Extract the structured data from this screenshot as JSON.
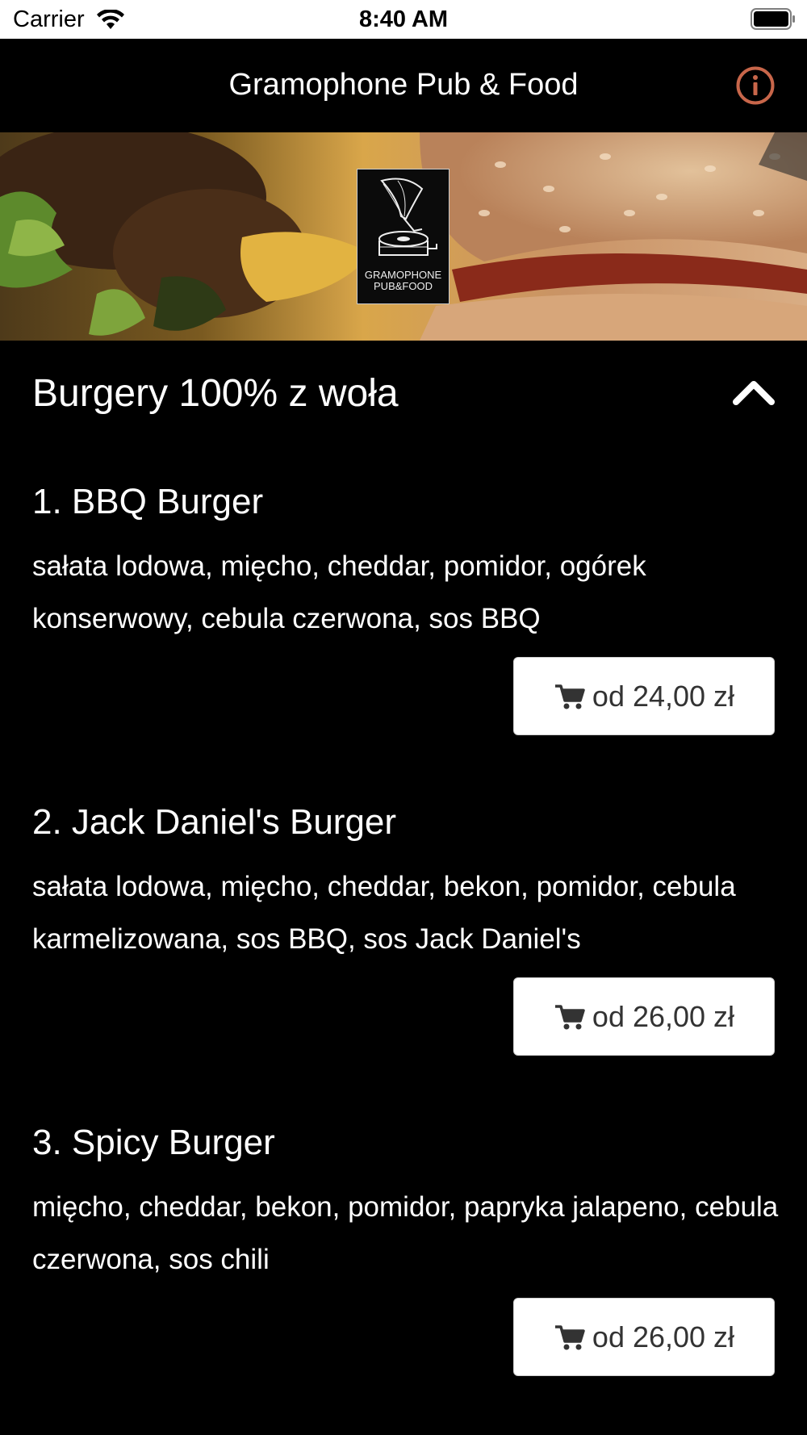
{
  "status_bar": {
    "carrier": "Carrier",
    "time": "8:40 AM"
  },
  "nav": {
    "title": "Gramophone Pub & Food",
    "info_icon": "info-circle-icon",
    "info_color": "#c8664a"
  },
  "hero": {
    "logo_text_line1": "GRAMOPHONE",
    "logo_text_line2": "PUB&FOOD"
  },
  "category": {
    "title": "Burgery 100% z woła",
    "toggle_icon": "chevron-up-icon"
  },
  "items": [
    {
      "name": "1. BBQ Burger",
      "description": "sałata lodowa, mięcho, cheddar, pomidor, ogórek konserwowy, cebula czerwona, sos BBQ",
      "price": "od 24,00 zł"
    },
    {
      "name": "2. Jack Daniel's Burger",
      "description": "sałata lodowa, mięcho, cheddar, bekon, pomidor, cebula karmelizowana, sos BBQ, sos Jack Daniel's",
      "price": "od 26,00 zł"
    },
    {
      "name": "3. Spicy Burger",
      "description": "mięcho, cheddar, bekon, pomidor, papryka jalapeno, cebula czerwona, sos chili",
      "price": "od 26,00 zł"
    }
  ],
  "colors": {
    "background": "#000000",
    "text": "#ffffff",
    "button_bg": "#ffffff",
    "button_text": "#333333",
    "accent": "#c8664a"
  }
}
